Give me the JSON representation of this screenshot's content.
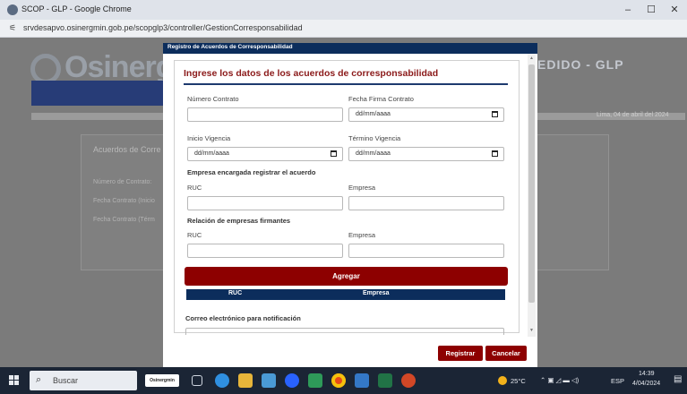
{
  "browser": {
    "window_title": "SCOP - GLP - Google Chrome",
    "url": "srvdesapvo.osinergmin.gob.pe/scopglp3/controller/GestionCorresponsabilidad",
    "minimize": "–",
    "maximize": "☐",
    "close": "✕"
  },
  "background": {
    "logo": "Osinerg",
    "right_title": "EDIDO - GLP",
    "date": "Lima, 04 de abril del 2024",
    "card_title": "Acuerdos de Corre",
    "labels": [
      "Número de Contrato:",
      "Fecha Contrato (Inicio",
      "Fecha Contrato (Térm"
    ]
  },
  "modal": {
    "header": "Registro de Acuerdos de Corresponsabilidad",
    "form_title": "Ingrese los datos de los acuerdos de corresponsabilidad",
    "numero_contrato_label": "Número Contrato",
    "fecha_firma_label": "Fecha Firma Contrato",
    "fecha_firma_placeholder": "dd/mm/aaaa",
    "inicio_vigencia_label": "Inicio Vigencia",
    "inicio_vigencia_placeholder": "dd/mm/aaaa",
    "termino_vigencia_label": "Término Vigencia",
    "termino_vigencia_placeholder": "dd/mm/aaaa",
    "empresa_encargada_section": "Empresa encargada registrar el acuerdo",
    "ruc_label_1": "RUC",
    "empresa_label_1": "Empresa",
    "relacion_section": "Relación de empresas firmantes",
    "ruc_label_2": "RUC",
    "empresa_label_2": "Empresa",
    "agregar_button": "Agregar",
    "table_headers": [
      "RUC",
      "Empresa"
    ],
    "email_label": "Correo electrónico para notificación",
    "registrar_button": "Registrar",
    "cancelar_button": "Cancelar"
  },
  "taskbar": {
    "search_placeholder": "Buscar",
    "osinergmin_app": "Osinergmin",
    "temperature": "25°C",
    "language": "ESP",
    "time": "14:39",
    "date": "4/04/2024"
  },
  "colors": {
    "brand_dark_red": "#8d0000",
    "navy": "#0c2d5c",
    "title_red": "#8b1a1a"
  }
}
